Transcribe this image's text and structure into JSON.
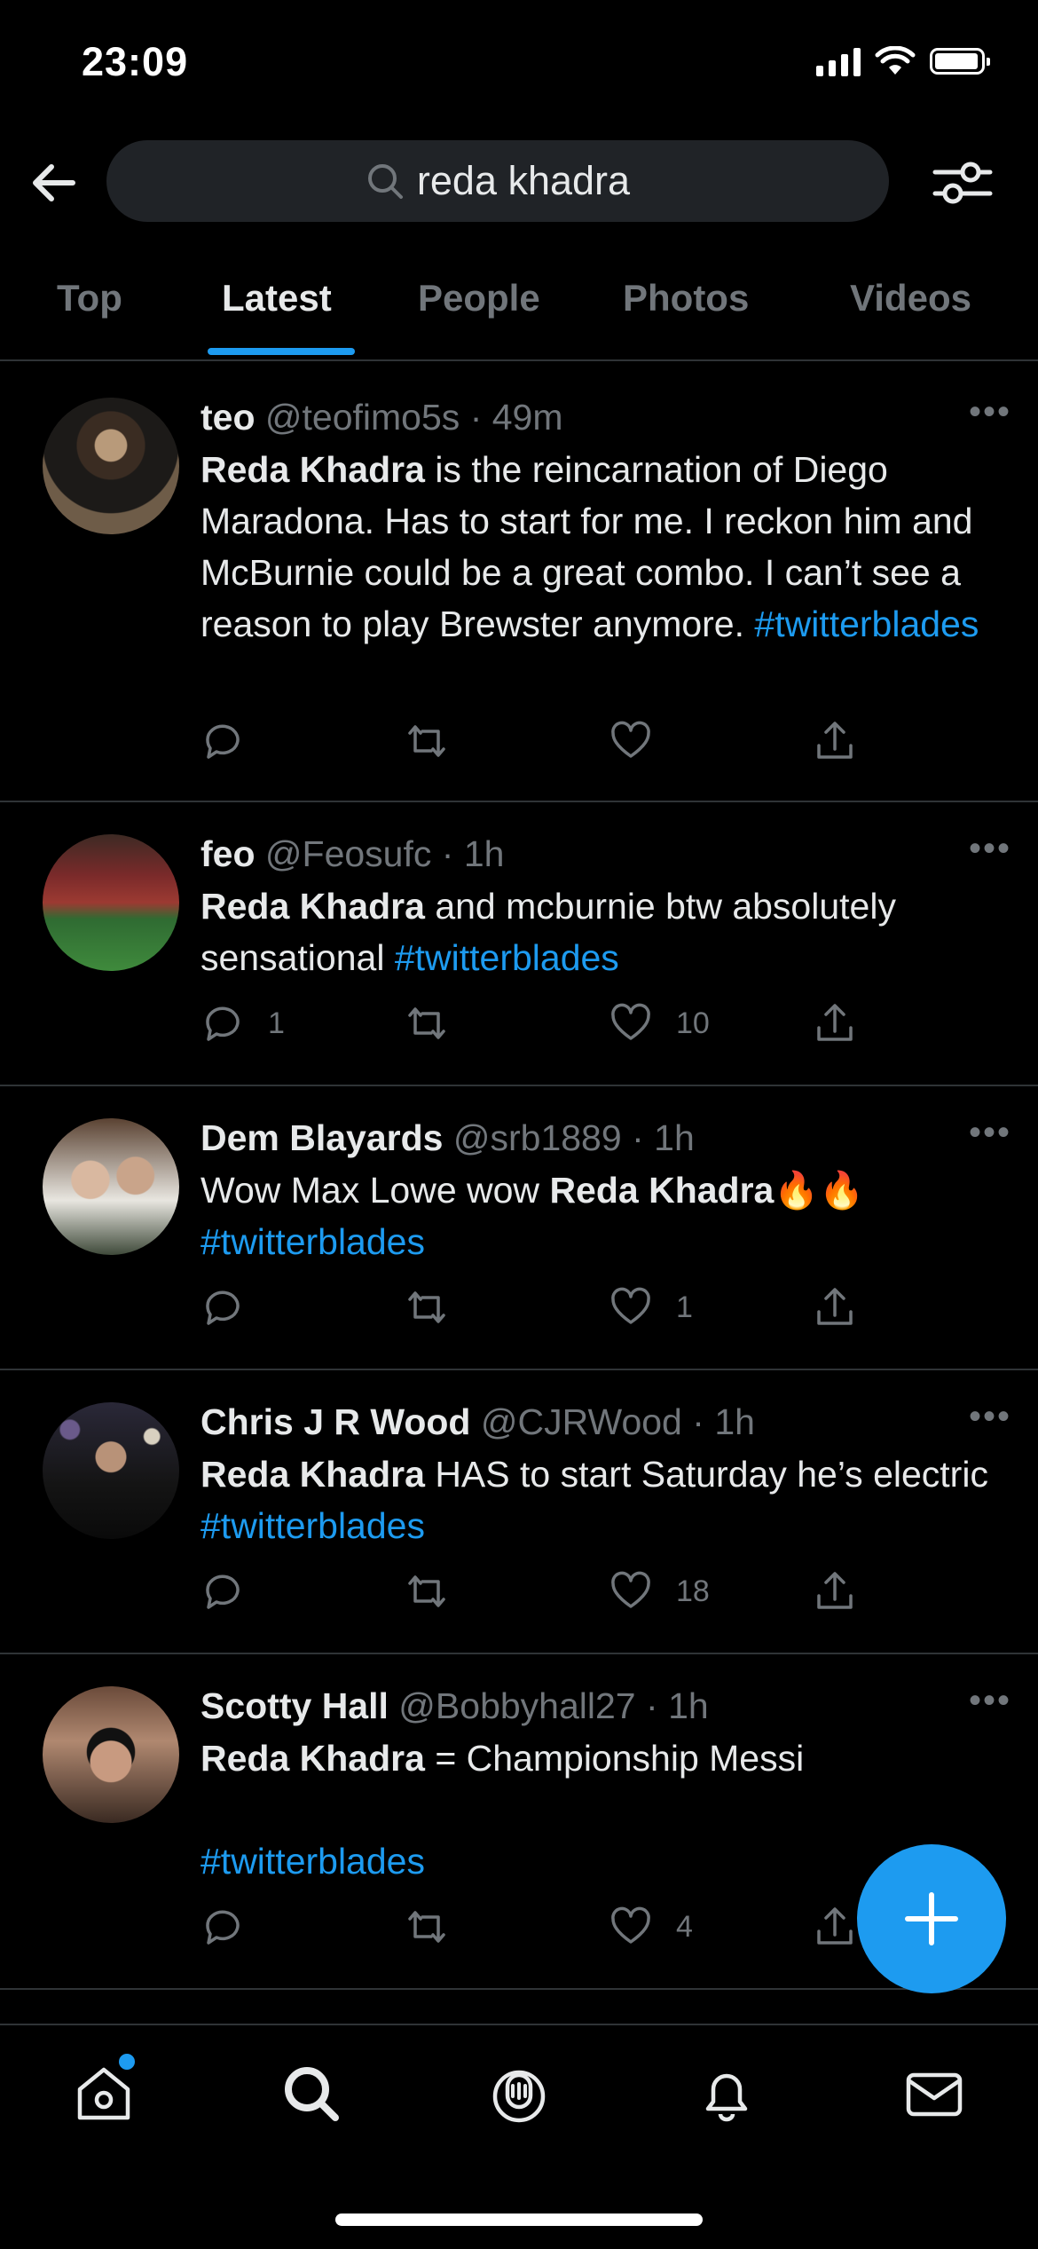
{
  "status": {
    "time": "23:09"
  },
  "search": {
    "query": "reda khadra"
  },
  "tabs": [
    "Top",
    "Latest",
    "People",
    "Photos",
    "Videos"
  ],
  "active_tab": "Latest",
  "colors": {
    "accent": "#1d9bf0",
    "background": "#000000",
    "secondary_text": "#71767b"
  },
  "tweets": [
    {
      "name": "teo",
      "handle": "@teofimo5s",
      "time": "49m",
      "bold": "Reda Khadra",
      "text": " is the reincarnation of Diego Maradona. Has to start for me. I reckon him and McBurnie could be a great combo. I can’t see a reason to play Brewster anymore. ",
      "hashtag": "#twitterblades",
      "replies": "",
      "likes": ""
    },
    {
      "name": "feo",
      "handle": "@Feosufc",
      "time": "1h",
      "bold": "Reda Khadra",
      "text": " and mcburnie btw absolutely sensational ",
      "hashtag": "#twitterblades",
      "replies": "1",
      "likes": "10"
    },
    {
      "name": "Dem Blayards",
      "handle": "@srb1889",
      "time": "1h",
      "pre": "Wow Max Lowe wow ",
      "bold": "Reda Khadra",
      "emoji": "🔥🔥",
      "hashtag": "#twitterblades",
      "replies": "",
      "likes": "1"
    },
    {
      "name": "Chris J R Wood",
      "handle": "@CJRWood",
      "time": "1h",
      "bold": "Reda Khadra",
      "text": " HAS to start Saturday he’s electric ",
      "hashtag": "#twitterblades",
      "replies": "",
      "likes": "18"
    },
    {
      "name": "Scotty Hall",
      "handle": "@Bobbyhall27",
      "time": "1h",
      "bold": "Reda Khadra",
      "text": " = Championship Messi",
      "hashtag": "#twitterblades",
      "replies": "",
      "likes": "4"
    }
  ],
  "bottom_nav": [
    "home-icon",
    "search-icon",
    "spaces-icon",
    "notifications-icon",
    "messages-icon"
  ]
}
